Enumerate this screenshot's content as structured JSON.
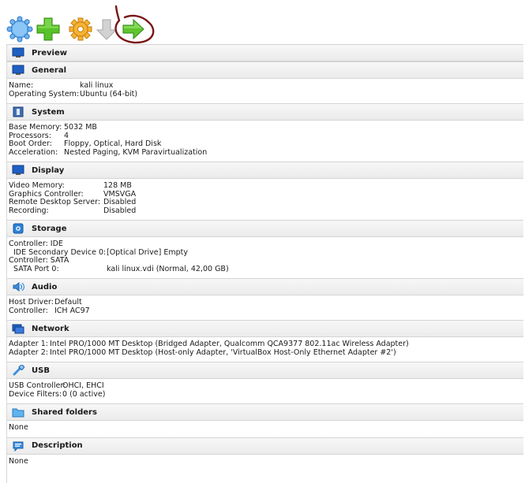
{
  "toolbar": {
    "buttons": [
      {
        "name": "new-button",
        "icon": "new-icon",
        "color": "#5ba0e6"
      },
      {
        "name": "add-button",
        "icon": "add-icon",
        "color": "#4caf1a"
      },
      {
        "name": "settings-button",
        "icon": "gear-icon",
        "color": "#f2a623"
      },
      {
        "name": "discard-button",
        "icon": "discard-arrow-icon",
        "color": "#bdbdbd"
      },
      {
        "name": "start-button",
        "icon": "start-arrow-icon",
        "color": "#59b82a"
      }
    ]
  },
  "sections": {
    "preview": {
      "title": "Preview"
    },
    "general": {
      "title": "General",
      "rows": [
        {
          "k": "Name:",
          "v": "kali linux"
        },
        {
          "k": "Operating System:",
          "v": "Ubuntu (64-bit)"
        }
      ]
    },
    "system": {
      "title": "System",
      "rows": [
        {
          "k": "Base Memory:",
          "v": "5032 MB"
        },
        {
          "k": "Processors:",
          "v": "4"
        },
        {
          "k": "Boot Order:",
          "v": "Floppy, Optical, Hard Disk"
        },
        {
          "k": "Acceleration:",
          "v": "Nested Paging, KVM Paravirtualization"
        }
      ]
    },
    "display": {
      "title": "Display",
      "rows": [
        {
          "k": "Video Memory:",
          "v": "128 MB"
        },
        {
          "k": "Graphics Controller:",
          "v": "VMSVGA"
        },
        {
          "k": "Remote Desktop Server:",
          "v": "Disabled"
        },
        {
          "k": "Recording:",
          "v": "Disabled"
        }
      ]
    },
    "storage": {
      "title": "Storage",
      "rows": [
        {
          "k": "Controller: IDE",
          "v": ""
        },
        {
          "k": "IDE Secondary Device 0:",
          "v": "[Optical Drive] Empty"
        },
        {
          "k": "Controller: SATA",
          "v": ""
        },
        {
          "k": "SATA Port 0:",
          "v": "kali linux.vdi (Normal, 42,00 GB)"
        }
      ]
    },
    "audio": {
      "title": "Audio",
      "rows": [
        {
          "k": "Host Driver:",
          "v": "Default"
        },
        {
          "k": "Controller:",
          "v": "ICH AC97"
        }
      ]
    },
    "network": {
      "title": "Network",
      "rows": [
        {
          "k": "Adapter 1:",
          "v": "Intel PRO/1000 MT Desktop (Bridged Adapter, Qualcomm QCA9377 802.11ac Wireless Adapter)"
        },
        {
          "k": "Adapter 2:",
          "v": "Intel PRO/1000 MT Desktop (Host-only Adapter, 'VirtualBox Host-Only Ethernet Adapter #2')"
        }
      ]
    },
    "usb": {
      "title": "USB",
      "rows": [
        {
          "k": "USB Controller:",
          "v": "OHCI, EHCI"
        },
        {
          "k": "Device Filters:",
          "v": "0 (0 active)"
        }
      ]
    },
    "shared_folders": {
      "title": "Shared folders",
      "rows": [
        {
          "k": "None",
          "v": ""
        }
      ]
    },
    "description": {
      "title": "Description",
      "rows": [
        {
          "k": "None",
          "v": ""
        }
      ]
    }
  },
  "annotation_color": "#7a1515"
}
